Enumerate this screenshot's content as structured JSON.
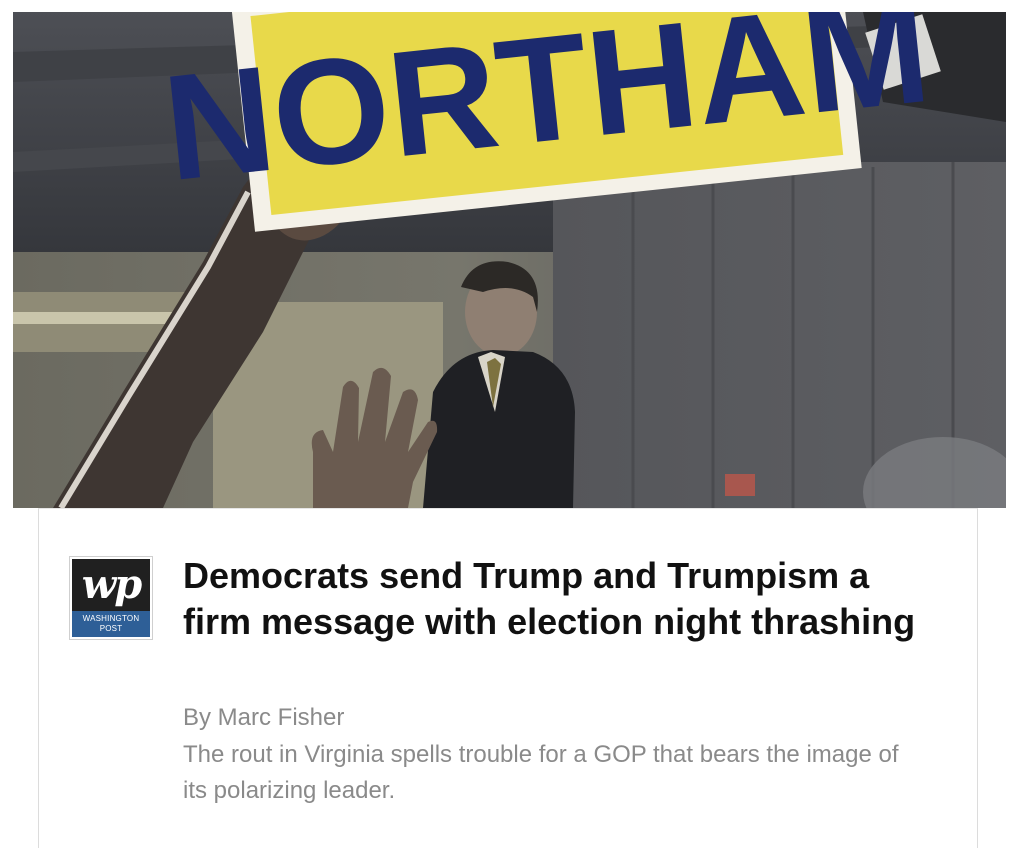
{
  "article": {
    "image": {
      "sign_text": "NORTHAM",
      "description_icon": "news-photo"
    },
    "publisher": {
      "logo_mark": "wp",
      "logo_line1": "WASHINGTON",
      "logo_line2": "POST",
      "logo_band_color": "#2e5f97"
    },
    "headline": "Democrats send Trump and Trumpism a firm message with election night thrashing",
    "byline": "By Marc Fisher",
    "summary": "The rout in Virginia spells trouble for a GOP that bears the image of its polarizing leader."
  },
  "colors": {
    "headline": "#111111",
    "secondary_text": "#8a8a8a",
    "sign_yellow": "#e8d94a",
    "sign_blue": "#1c2a6e"
  }
}
